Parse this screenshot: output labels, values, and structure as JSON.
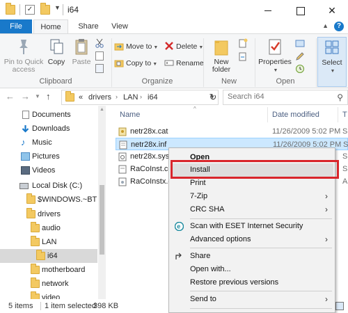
{
  "window": {
    "title": "i64",
    "min_label": "",
    "max_label": "",
    "close_label": "✕"
  },
  "ribbon_tabs": [
    "File",
    "Home",
    "Share",
    "View"
  ],
  "ribbon": {
    "clipboard": {
      "label": "Clipboard",
      "pin": "Pin to Quick access",
      "copy": "Copy",
      "paste": "Paste"
    },
    "organize": {
      "label": "Organize",
      "move_to": "Move to",
      "copy_to": "Copy to",
      "delete": "Delete",
      "rename": "Rename"
    },
    "new": {
      "label": "New",
      "new_folder": "New folder"
    },
    "open": {
      "label": "Open",
      "properties": "Properties"
    },
    "select": {
      "label": "Select"
    }
  },
  "address": {
    "overflow": "«",
    "crumbs": [
      "drivers",
      "LAN",
      "i64"
    ],
    "search_placeholder": "Search i64"
  },
  "nav_pane": {
    "items": [
      {
        "label": "Documents",
        "icon": "documents-icon"
      },
      {
        "label": "Downloads",
        "icon": "downloads-icon"
      },
      {
        "label": "Music",
        "icon": "music-icon"
      },
      {
        "label": "Pictures",
        "icon": "pictures-icon"
      },
      {
        "label": "Videos",
        "icon": "videos-icon"
      },
      {
        "label": "Local Disk (C:)",
        "icon": "drive-icon"
      },
      {
        "label": "$WINDOWS.~BT",
        "icon": "folder-icon"
      },
      {
        "label": "drivers",
        "icon": "folder-icon"
      },
      {
        "label": "audio",
        "icon": "folder-icon"
      },
      {
        "label": "LAN",
        "icon": "folder-icon"
      },
      {
        "label": "i64",
        "icon": "folder-icon"
      },
      {
        "label": "motherboard",
        "icon": "folder-icon"
      },
      {
        "label": "network",
        "icon": "folder-icon"
      },
      {
        "label": "video",
        "icon": "folder-icon"
      }
    ]
  },
  "file_list": {
    "columns": [
      "Name",
      "Date modified",
      "T"
    ],
    "files": [
      {
        "name": "netr28x.cat",
        "date": "11/26/2009 5:02 PM",
        "type": "S"
      },
      {
        "name": "netr28x.inf",
        "date": "11/26/2009 5:02 PM",
        "type": "S"
      },
      {
        "name": "netr28x.sys",
        "date": "",
        "type": "S"
      },
      {
        "name": "RaCoInst.cer",
        "date": "",
        "type": "S"
      },
      {
        "name": "RaCoInstx.dll",
        "date": "",
        "type": "A"
      }
    ]
  },
  "status": {
    "count": "5 items",
    "selection": "1 item selected",
    "size": "398 KB"
  },
  "context_menu": {
    "items": [
      {
        "label": "Open",
        "bold": true
      },
      {
        "label": "Install",
        "hover": true
      },
      {
        "label": "Print"
      },
      {
        "label": "7-Zip",
        "submenu": true
      },
      {
        "label": "CRC SHA",
        "submenu": true
      },
      {
        "label": "Scan with ESET Internet Security",
        "icon": "eset-icon"
      },
      {
        "label": "Advanced options",
        "submenu": true
      },
      {
        "label": "Share",
        "icon": "share-icon"
      },
      {
        "label": "Open with..."
      },
      {
        "label": "Restore previous versions"
      },
      {
        "label": "Send to",
        "submenu": true
      }
    ]
  },
  "colors": {
    "accent": "#1979ca",
    "highlight_box": "#d9262c",
    "selection": "#cce8ff",
    "menu_hover": "#dedede"
  }
}
